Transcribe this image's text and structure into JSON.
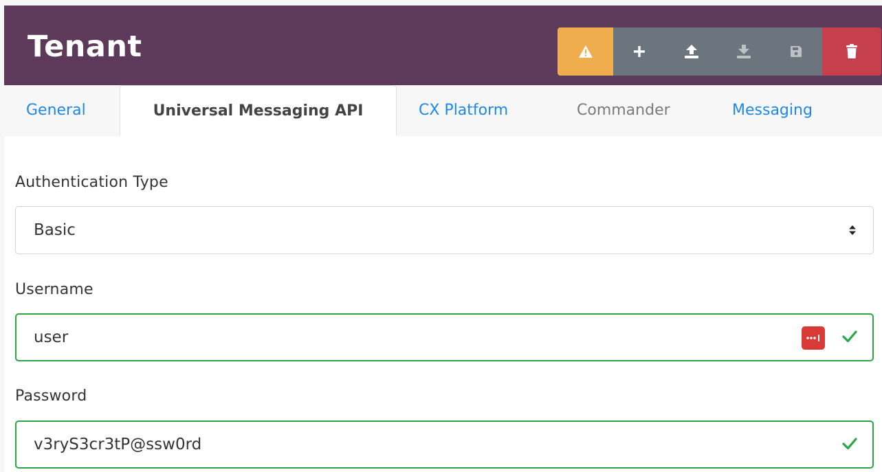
{
  "header": {
    "title": "Tenant",
    "colors": {
      "background": "#5d3a5a",
      "warning": "#f0ad4e",
      "secondary": "#6c757d",
      "danger": "#c63f4c"
    },
    "toolbar": [
      {
        "name": "warning",
        "icon": "warning-triangle-icon"
      },
      {
        "name": "add",
        "icon": "plus-icon"
      },
      {
        "name": "upload",
        "icon": "upload-icon"
      },
      {
        "name": "download",
        "icon": "download-icon",
        "disabled": true
      },
      {
        "name": "save",
        "icon": "floppy-disk-icon",
        "disabled": true
      },
      {
        "name": "delete",
        "icon": "trash-icon"
      }
    ]
  },
  "tabs": [
    {
      "label": "General"
    },
    {
      "label": "Universal Messaging API",
      "active": true
    },
    {
      "label": "CX Platform"
    },
    {
      "label": "Commander",
      "disabled": true
    },
    {
      "label": "Messaging"
    }
  ],
  "form": {
    "auth_type": {
      "label": "Authentication Type",
      "value": "Basic"
    },
    "username": {
      "label": "Username",
      "value": "user",
      "icons": [
        "password-manager-icon",
        "checkmark-icon"
      ]
    },
    "password": {
      "label": "Password",
      "value": "v3ryS3cr3tP@ssw0rd",
      "icons": [
        "checkmark-icon"
      ]
    },
    "valid_color": "#28a745"
  }
}
